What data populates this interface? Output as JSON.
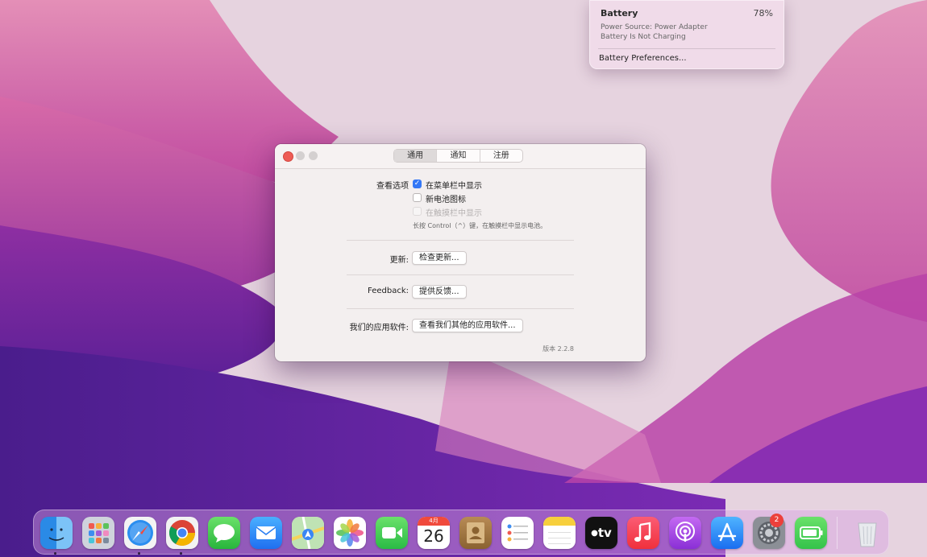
{
  "battery_menu": {
    "title": "Battery",
    "percent": "78%",
    "power_source": "Power Source: Power Adapter",
    "status": "Battery Is Not Charging",
    "preferences": "Battery Preferences..."
  },
  "window": {
    "tabs": [
      {
        "label": "通用",
        "active": true
      },
      {
        "label": "通知",
        "active": false
      },
      {
        "label": "注册",
        "active": false
      }
    ],
    "view_options_label": "查看选项",
    "options": [
      {
        "label": "在菜单栏中显示",
        "checked": true,
        "disabled": false
      },
      {
        "label": "新电池图标",
        "checked": false,
        "disabled": false
      },
      {
        "label": "在触摸栏中显示",
        "checked": false,
        "disabled": true
      }
    ],
    "hint": "长按 Control（^）键，在触摸栏中显示电池。",
    "update_label": "更新:",
    "update_button": "检查更新...",
    "feedback_label": "Feedback:",
    "feedback_button": "提供反馈...",
    "apps_label": "我们的应用软件:",
    "apps_button": "查看我们其他的应用软件...",
    "version": "版本 2.2.8"
  },
  "dock": {
    "calendar_month": "4月",
    "calendar_day": "26",
    "settings_badge": "2",
    "apps": [
      "finder-icon",
      "launchpad-icon",
      "safari-icon",
      "chrome-icon",
      "messages-icon",
      "mail-icon",
      "maps-icon",
      "photos-icon",
      "facetime-icon",
      "calendar-icon",
      "contacts-icon",
      "reminders-icon",
      "notes-icon",
      "apple-tv-icon",
      "music-icon",
      "podcasts-icon",
      "app-store-icon",
      "system-preferences-icon",
      "battery-app-icon",
      "trash-icon"
    ],
    "apple_tv_label": "tv"
  }
}
